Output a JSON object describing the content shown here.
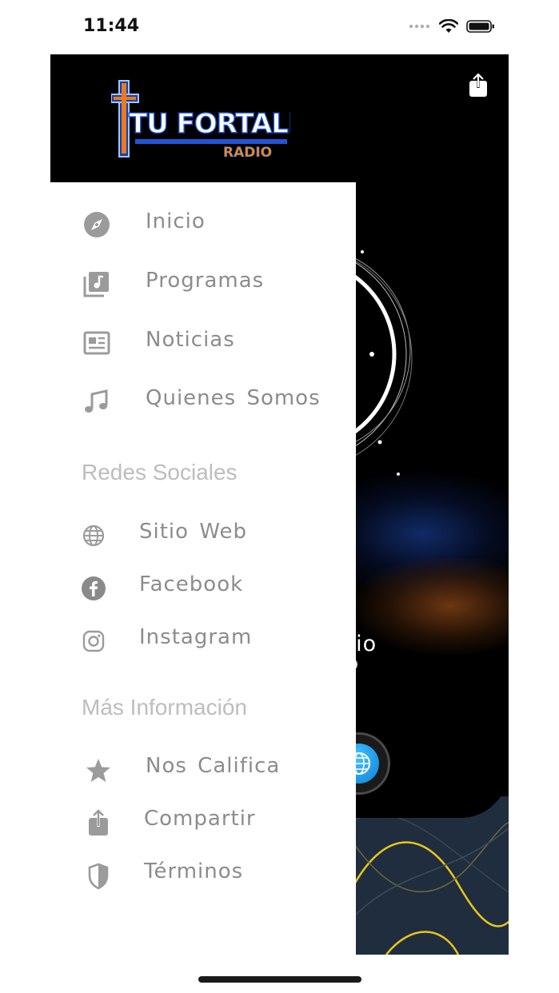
{
  "status": {
    "time": "11:44"
  },
  "header": {
    "logo_text": "TU FORTALEZA",
    "logo_sub": "RADIO"
  },
  "player": {
    "station_fragment": "dio"
  },
  "menu": {
    "main_items": [
      {
        "label": "Inicio",
        "icon": "compass-icon"
      },
      {
        "label": "Programas",
        "icon": "music-library-icon"
      },
      {
        "label": "Noticias",
        "icon": "newspaper-icon"
      },
      {
        "label": "Quienes Somos",
        "icon": "music-note-icon"
      }
    ],
    "social_title": "Redes Sociales",
    "social_items": [
      {
        "label": "Sitio Web",
        "icon": "globe-icon"
      },
      {
        "label": "Facebook",
        "icon": "facebook-icon"
      },
      {
        "label": "Instagram",
        "icon": "instagram-icon"
      }
    ],
    "info_title": "Más Información",
    "info_items": [
      {
        "label": "Nos Califica",
        "icon": "star-icon"
      },
      {
        "label": "Compartir",
        "icon": "share-icon"
      },
      {
        "label": "Términos",
        "icon": "shield-icon"
      }
    ]
  },
  "colors": {
    "drawer_bg": "#ffffff",
    "menu_text": "#8c8c8c",
    "section_text": "#bdbdbd",
    "wave_accent": "#e8c61a",
    "panel_bg": "#1f2d3f"
  }
}
